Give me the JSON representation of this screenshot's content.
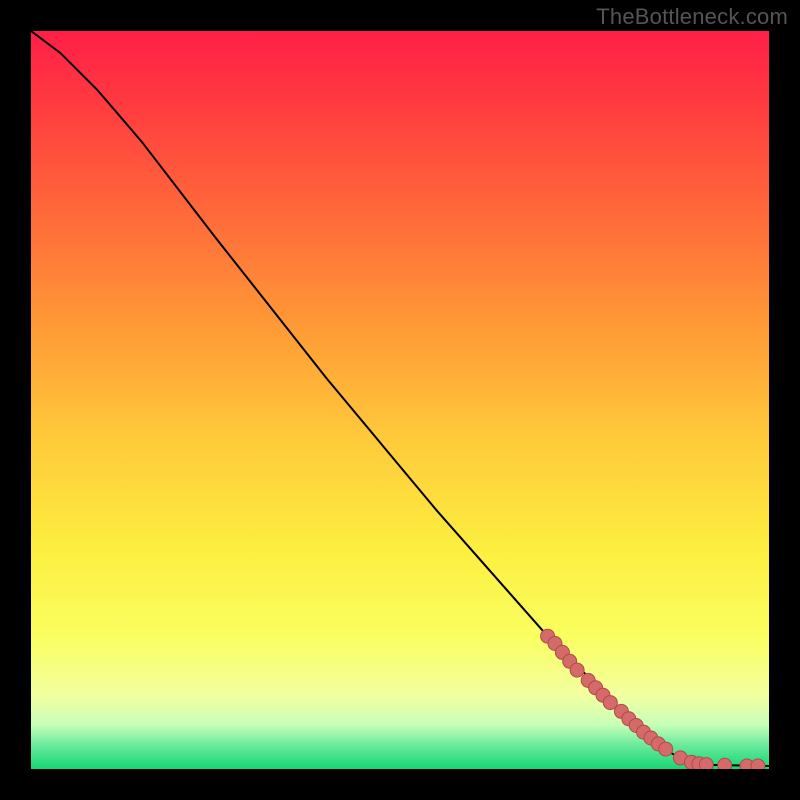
{
  "watermark": "TheBottleneck.com",
  "chart_data": {
    "type": "line",
    "title": "",
    "xlabel": "",
    "ylabel": "",
    "xlim": [
      0,
      100
    ],
    "ylim": [
      0,
      100
    ],
    "grid": false,
    "legend": false,
    "curve": [
      {
        "x": 0,
        "y": 100
      },
      {
        "x": 4,
        "y": 97
      },
      {
        "x": 9,
        "y": 92
      },
      {
        "x": 15,
        "y": 85
      },
      {
        "x": 25,
        "y": 72
      },
      {
        "x": 40,
        "y": 53
      },
      {
        "x": 55,
        "y": 35
      },
      {
        "x": 70,
        "y": 18
      },
      {
        "x": 80,
        "y": 8
      },
      {
        "x": 86,
        "y": 2.5
      },
      {
        "x": 90,
        "y": 0.6
      },
      {
        "x": 100,
        "y": 0.4
      }
    ],
    "markers": [
      {
        "x": 70,
        "y": 18
      },
      {
        "x": 71,
        "y": 17
      },
      {
        "x": 72,
        "y": 15.8
      },
      {
        "x": 73,
        "y": 14.6
      },
      {
        "x": 74,
        "y": 13.4
      },
      {
        "x": 75.5,
        "y": 12
      },
      {
        "x": 76.5,
        "y": 11
      },
      {
        "x": 77.5,
        "y": 10
      },
      {
        "x": 78.5,
        "y": 9
      },
      {
        "x": 80,
        "y": 7.8
      },
      {
        "x": 81,
        "y": 6.8
      },
      {
        "x": 82,
        "y": 5.9
      },
      {
        "x": 83,
        "y": 5
      },
      {
        "x": 84,
        "y": 4.2
      },
      {
        "x": 85,
        "y": 3.4
      },
      {
        "x": 86,
        "y": 2.7
      },
      {
        "x": 88,
        "y": 1.5
      },
      {
        "x": 89.5,
        "y": 0.9
      },
      {
        "x": 90.5,
        "y": 0.7
      },
      {
        "x": 91.5,
        "y": 0.6
      },
      {
        "x": 94,
        "y": 0.5
      },
      {
        "x": 97,
        "y": 0.4
      },
      {
        "x": 98.5,
        "y": 0.4
      }
    ],
    "colors": {
      "curve": "#000000",
      "marker_fill": "#d46a6a",
      "marker_stroke": "#b24a4a"
    }
  }
}
